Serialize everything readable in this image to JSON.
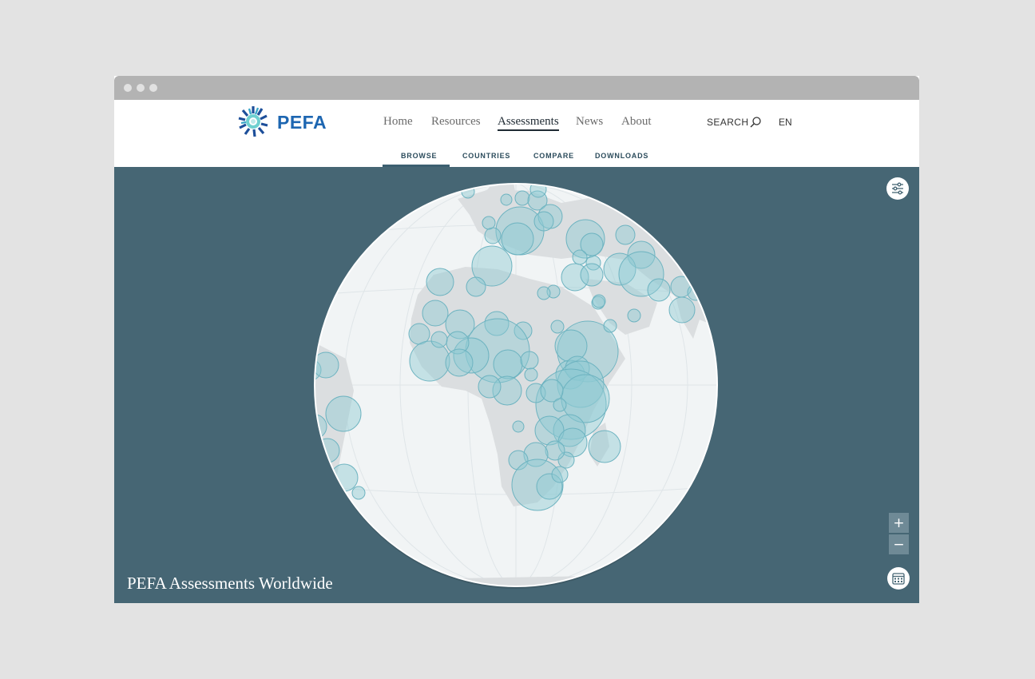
{
  "brand": {
    "name": "PEFA"
  },
  "nav": {
    "items": [
      {
        "label": "Home"
      },
      {
        "label": "Resources"
      },
      {
        "label": "Assessments"
      },
      {
        "label": "News"
      },
      {
        "label": "About"
      }
    ],
    "search_label": "SEARCH",
    "language": "EN"
  },
  "subnav": {
    "items": [
      {
        "label": "BROWSE"
      },
      {
        "label": "COUNTRIES"
      },
      {
        "label": "COMPARE"
      },
      {
        "label": "DOWNLOADS"
      }
    ]
  },
  "map": {
    "title": "PEFA Assessments Worldwide",
    "zoom_in": "+",
    "zoom_out": "−",
    "colors": {
      "ocean": "#466674",
      "globe": "#f1f4f5",
      "land": "#dbdee0",
      "bubble_fill": "#8ec9d3",
      "bubble_stroke": "#6db3c0"
    }
  },
  "icons": {
    "filter": "sliders-icon",
    "calendar": "calendar-icon",
    "search": "search-icon"
  }
}
